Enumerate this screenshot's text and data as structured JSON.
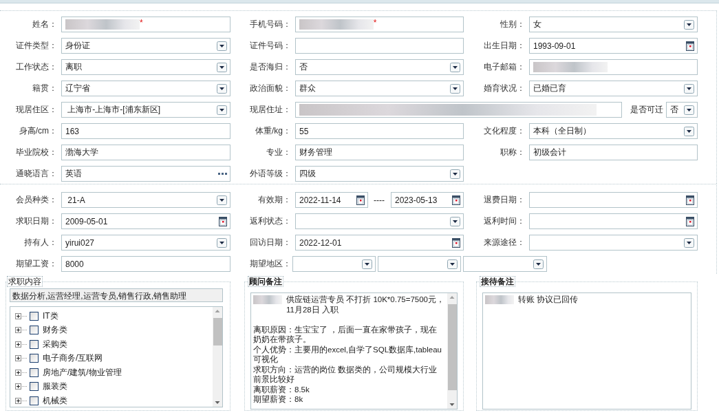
{
  "sections": [
    {
      "rows": [
        [
          {
            "label": "姓名：",
            "kind": "text",
            "blurred": true,
            "required_mark": "*"
          },
          {
            "label": "手机号码：",
            "kind": "text",
            "blurred": true,
            "required_mark": "*"
          },
          {
            "label": "性别：",
            "kind": "select",
            "value": "女"
          }
        ],
        [
          {
            "label": "证件类型：",
            "kind": "select",
            "value": "身份证"
          },
          {
            "label": "证件号码：",
            "kind": "text"
          },
          {
            "label": "出生日期：",
            "kind": "date",
            "value": "1993-09-01"
          }
        ],
        [
          {
            "label": "工作状态：",
            "kind": "select",
            "value": "离职"
          },
          {
            "label": "是否海归：",
            "kind": "select",
            "value": "否"
          },
          {
            "label": "电子邮箱：",
            "kind": "text",
            "blurred": true
          }
        ],
        [
          {
            "label": "籍贯：",
            "kind": "select",
            "value": "辽宁省"
          },
          {
            "label": "政治面貌：",
            "kind": "select",
            "value": "群众"
          },
          {
            "label": "婚育状况：",
            "kind": "select",
            "value": "已婚已育"
          }
        ],
        [
          {
            "label": "现居住区：",
            "kind": "select",
            "value": " 上海市-上海市-[浦东新区]"
          },
          {
            "label": "现居住址：",
            "kind": "address",
            "parts": [
              {
                "kind": "text",
                "blurred": true
              },
              {
                "kind": "label",
                "text": "是否可迁"
              },
              {
                "kind": "select",
                "value": "否"
              }
            ]
          }
        ],
        [
          {
            "label": "身高/cm：",
            "kind": "text",
            "value": "163"
          },
          {
            "label": "体重/kg：",
            "kind": "text",
            "value": "55"
          },
          {
            "label": "文化程度：",
            "kind": "select",
            "value": "本科（全日制）"
          }
        ],
        [
          {
            "label": "毕业院校：",
            "kind": "text",
            "value": "渤海大学"
          },
          {
            "label": "专业：",
            "kind": "text",
            "value": "财务管理"
          },
          {
            "label": "职称：",
            "kind": "text",
            "value": "初级会计"
          }
        ],
        [
          {
            "label": "通晓语言：",
            "kind": "lookup",
            "value": "英语"
          },
          {
            "label": "外语等级：",
            "kind": "select",
            "value": "四级"
          }
        ]
      ]
    },
    {
      "rows": [
        [
          {
            "label": "会员种类：",
            "kind": "select",
            "value": " 21-A"
          },
          {
            "label": "有效期：",
            "kind": "range",
            "parts": [
              {
                "kind": "date",
                "value": "2022-11-14"
              },
              {
                "kind": "separator",
                "text": "----"
              },
              {
                "kind": "date",
                "value": "2023-05-13"
              }
            ]
          },
          {
            "label": "退费日期：",
            "kind": "date"
          }
        ],
        [
          {
            "label": "求职日期：",
            "kind": "date",
            "value": "2009-05-01"
          },
          {
            "label": "返利状态：",
            "kind": "select"
          },
          {
            "label": "返利时间：",
            "kind": "date"
          }
        ],
        [
          {
            "label": "持有人：",
            "kind": "select",
            "value": "yirui027"
          },
          {
            "label": "回访日期：",
            "kind": "date",
            "value": "2022-12-01"
          },
          {
            "label": "来源途径：",
            "kind": "select"
          }
        ],
        [
          {
            "label": "期望工资：",
            "kind": "text",
            "value": "8000"
          },
          {
            "label": "期望地区：",
            "kind": "region",
            "parts": [
              {
                "kind": "select"
              },
              {
                "kind": "select"
              },
              {
                "kind": "select"
              }
            ]
          }
        ]
      ]
    }
  ],
  "panels": [
    {
      "kind": "tree",
      "title": "求职内容",
      "bold_title": false,
      "summary": "数据分析,运营经理,运营专员,销售行政,销售助理",
      "items": [
        {
          "label": "IT类",
          "expanded": false,
          "checked": false
        },
        {
          "label": "财务类",
          "expanded": false,
          "checked": false
        },
        {
          "label": "采购类",
          "expanded": false,
          "checked": false
        },
        {
          "label": "电子商务/互联网",
          "expanded": false,
          "checked": false
        },
        {
          "label": "房地产/建筑/物业管理",
          "expanded": false,
          "checked": false
        },
        {
          "label": "服装类",
          "expanded": false,
          "checked": false
        },
        {
          "label": "机械类",
          "expanded": false,
          "checked": false
        }
      ]
    },
    {
      "kind": "note",
      "title": "顾问备注",
      "bold_title": true,
      "blurred_prefix": true,
      "scrollable": true,
      "lines": [
        {
          "text": "供应链运营专员 不打折 10K*0.75=7500元，11月28日 入职",
          "gap_after": true
        },
        {
          "text": "离职原因：生宝宝了 ，后面一直在家带孩子，现在奶奶在带孩子。"
        },
        {
          "text": "个人优势：主要用的excel,自学了SQL数据库,tableau可视化"
        },
        {
          "text": "求职方向：运营的岗位 数据类的，公司规模大行业前景比较好"
        },
        {
          "text": "离职薪资：8.5k"
        },
        {
          "text": "期望薪资：8k"
        }
      ]
    },
    {
      "kind": "note",
      "title": "接待备注",
      "bold_title": true,
      "blurred_prefix": true,
      "scrollable": false,
      "lines": [
        {
          "text": "转账 协议已回传"
        }
      ]
    }
  ]
}
